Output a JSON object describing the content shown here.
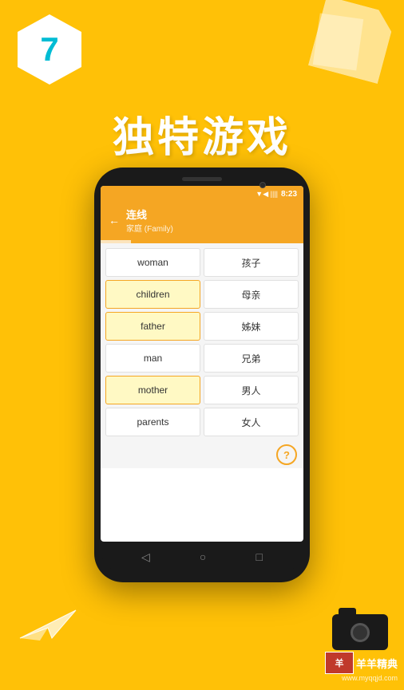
{
  "badge": {
    "number": "7"
  },
  "title": "独特游戏",
  "statusBar": {
    "time": "8:23",
    "signal": "▼◀ ▪▪▪▪"
  },
  "appHeader": {
    "back": "←",
    "title": "连线",
    "subtitle": "家庭 (Family)"
  },
  "wordGrid": {
    "leftColumn": [
      "woman",
      "children",
      "father",
      "man",
      "mother",
      "parents"
    ],
    "rightColumn": [
      "孩子",
      "母亲",
      "姊妹",
      "兄弟",
      "男人",
      "女人"
    ]
  },
  "helpButton": "?",
  "navButtons": {
    "back": "◁",
    "home": "○",
    "recent": "□"
  },
  "watermark": {
    "logo": "羊",
    "text": "羊羊精典",
    "url": "www.myqqjd.com"
  }
}
